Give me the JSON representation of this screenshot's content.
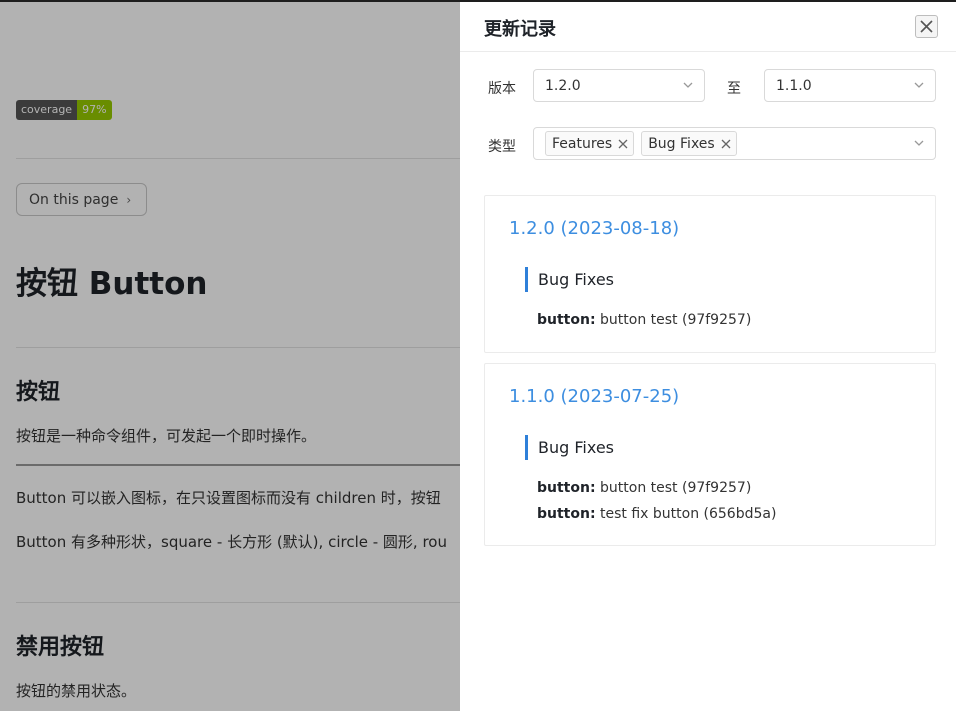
{
  "page": {
    "badge": {
      "label": "coverage",
      "value": "97%",
      "value_color": "#97ca00"
    },
    "toc_button": "On this page",
    "title": "按钮 Button",
    "sections": [
      {
        "heading": "按钮",
        "text": "按钮是一种命令组件，可发起一个即时操作。"
      },
      {
        "text": "Button 可以嵌入图标，在只设置图标而没有 children 时，按钮"
      },
      {
        "text": "Button 有多种形状，square - 长方形 (默认), circle - 圆形, rou"
      },
      {
        "heading": "禁用按钮",
        "text": "按钮的禁用状态。"
      }
    ]
  },
  "drawer": {
    "title": "更新记录",
    "filters": {
      "version_label": "版本",
      "from_version": "1.2.0",
      "to_label": "至",
      "to_version": "1.1.0",
      "type_label": "类型",
      "type_tags": [
        "Features",
        "Bug Fixes"
      ]
    },
    "releases": [
      {
        "title": "1.2.0 (2023-08-18)",
        "groups": [
          {
            "name": "Bug Fixes",
            "items": [
              {
                "scope": "button:",
                "text": "button test (97f9257)"
              }
            ]
          }
        ]
      },
      {
        "title": "1.1.0 (2023-07-25)",
        "groups": [
          {
            "name": "Bug Fixes",
            "items": [
              {
                "scope": "button:",
                "text": "button test (97f9257)"
              },
              {
                "scope": "button:",
                "text": "test fix button (656bd5a)"
              }
            ]
          }
        ]
      }
    ],
    "accent_color": "#3d8ee0"
  }
}
